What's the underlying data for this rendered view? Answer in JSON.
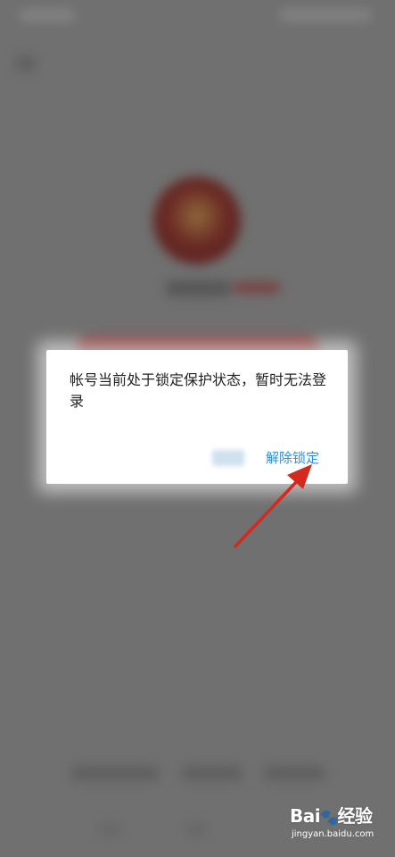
{
  "dialog": {
    "message": "帐号当前处于锁定保护状态，暂时无法登录",
    "unlock_label": "解除锁定"
  },
  "watermark": {
    "logo": "Bai",
    "logo_suffix": "经验",
    "url": "jingyan.baidu.com"
  },
  "colors": {
    "dialog_background": "#ffffff",
    "action_link": "#2f8fd6",
    "annotation_arrow": "#d42a1e",
    "overlay": "#707070",
    "login_bar": "#7a3030"
  },
  "icons": {
    "back": "back-arrow-icon",
    "paw": "baidu-paw-icon"
  }
}
